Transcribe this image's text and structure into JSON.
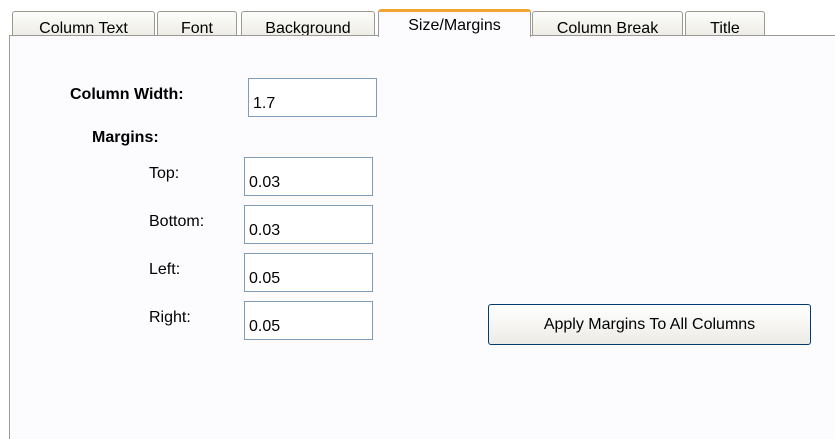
{
  "tabs": [
    {
      "label": "Column Text",
      "active": false
    },
    {
      "label": "Font",
      "active": false
    },
    {
      "label": "Background",
      "active": false
    },
    {
      "label": "Size/Margins",
      "active": true
    },
    {
      "label": "Column Break",
      "active": false
    },
    {
      "label": "Title",
      "active": false
    }
  ],
  "form": {
    "column_width": {
      "label": "Column Width:",
      "value": "1.7"
    },
    "margins_heading": "Margins:",
    "top": {
      "label": "Top:",
      "value": "0.03"
    },
    "bottom": {
      "label": "Bottom:",
      "value": "0.03"
    },
    "left": {
      "label": "Left:",
      "value": "0.05"
    },
    "right": {
      "label": "Right:",
      "value": "0.05"
    },
    "apply_button": "Apply Margins To All Columns"
  },
  "colors": {
    "active_tab_accent": "#f2a532",
    "field_border": "#7f9db9",
    "button_border": "#003c74"
  }
}
